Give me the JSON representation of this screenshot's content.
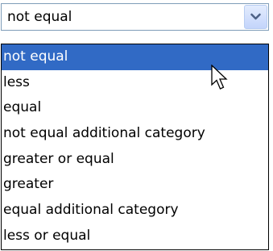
{
  "select": {
    "value": "not equal",
    "button_icon": "chevron-down-icon"
  },
  "dropdown": {
    "selected_index": 0,
    "options": [
      "not equal",
      "less",
      "equal",
      "not equal additional category",
      "greater or equal",
      "greater",
      "equal additional category",
      "less or equal"
    ]
  },
  "colors": {
    "selection_background": "#316ac5",
    "selection_text": "#ffffff",
    "field_border": "#7f9db9",
    "list_border": "#000000",
    "arrow": "#4d6185"
  },
  "cursor_icon": "mouse-pointer-icon"
}
